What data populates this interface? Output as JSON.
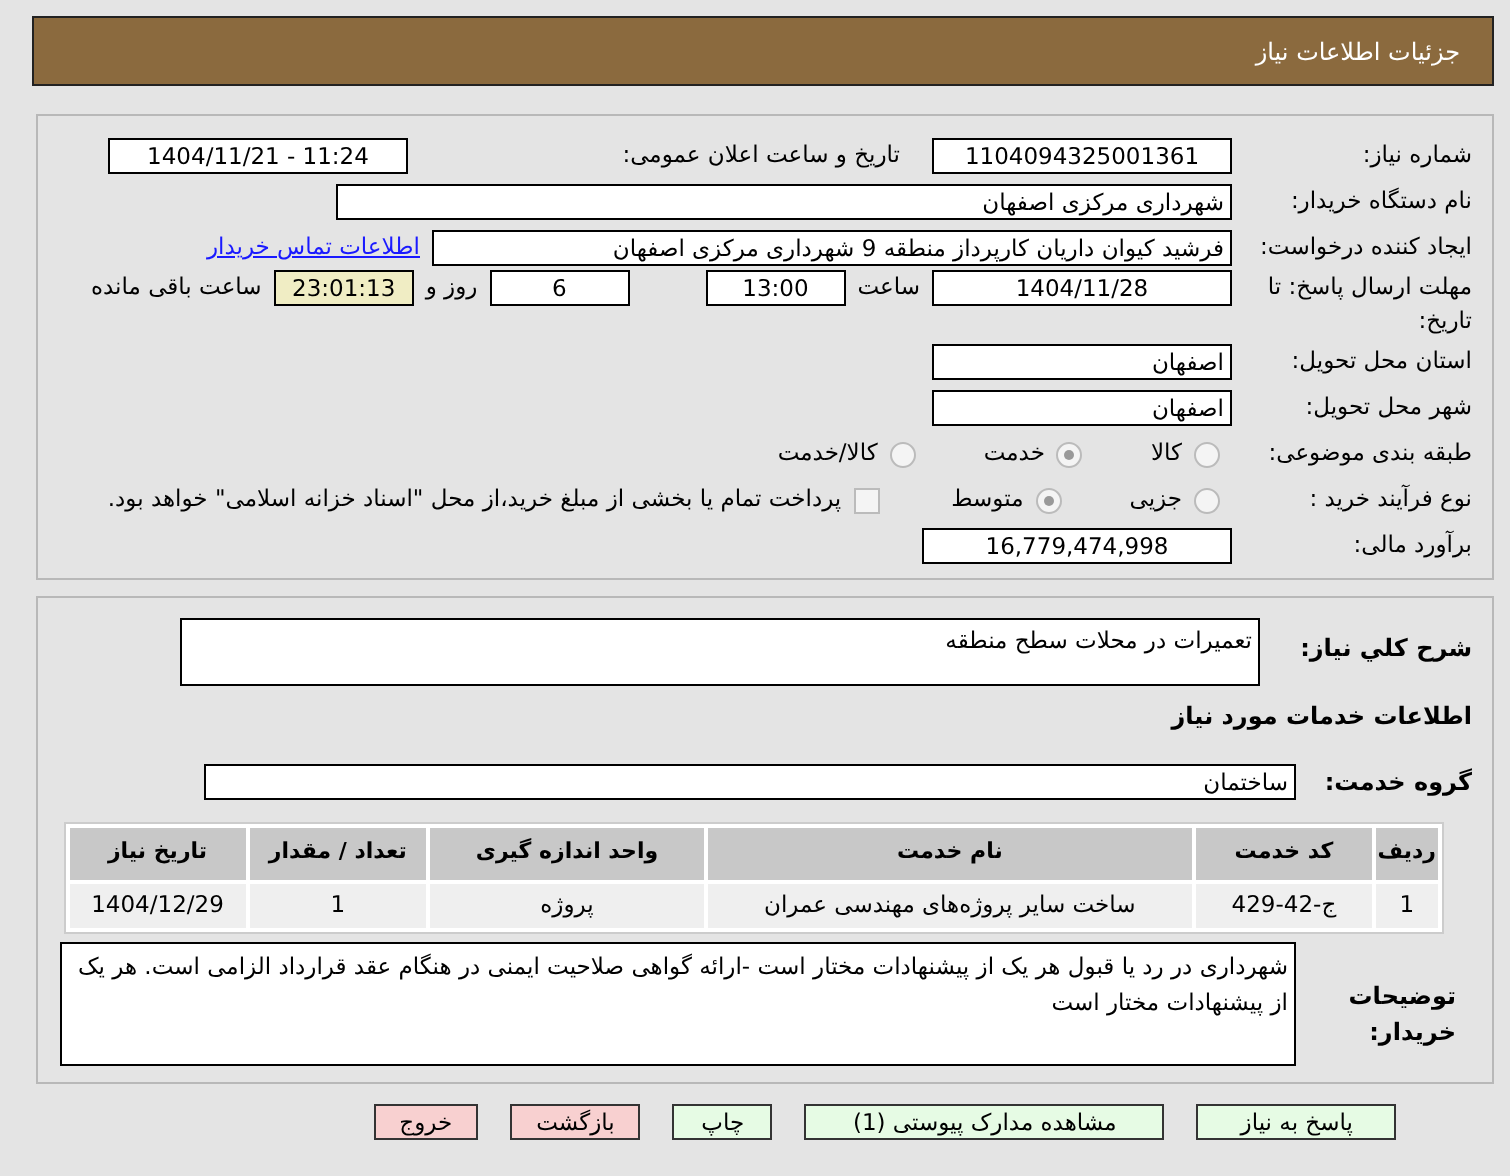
{
  "header": {
    "title": "جزئیات اطلاعات نیاز"
  },
  "need_number": {
    "label": "شماره نیاز:",
    "value": "1104094325001361"
  },
  "announce": {
    "label": "تاریخ و ساعت اعلان عمومی:",
    "value": "1404/11/21 - 11:24"
  },
  "buyer_org": {
    "label": "نام دستگاه خریدار:",
    "value": "شهرداری مرکزی اصفهان"
  },
  "requester": {
    "label": "ایجاد کننده درخواست:",
    "value": "فرشید کیوان داریان کارپرداز منطقه 9 شهرداری مرکزی اصفهان",
    "link": "اطلاعات تماس خریدار"
  },
  "deadline": {
    "label": "مهلت ارسال پاسخ: تا تاریخ:",
    "date": "1404/11/28",
    "time_label": "ساعت",
    "time": "13:00",
    "days": "6",
    "days_label": "روز و",
    "remaining": "23:01:13",
    "remaining_label": "ساعت باقی مانده"
  },
  "province": {
    "label": "استان محل تحویل:",
    "value": "اصفهان"
  },
  "city": {
    "label": "شهر محل تحویل:",
    "value": "اصفهان"
  },
  "category": {
    "label": "طبقه بندی موضوعی:",
    "options": [
      {
        "label": "کالا",
        "selected": false
      },
      {
        "label": "خدمت",
        "selected": true
      },
      {
        "label": "کالا/خدمت",
        "selected": false
      }
    ]
  },
  "process": {
    "label": "نوع فرآیند خرید :",
    "options": [
      {
        "label": "جزیی",
        "selected": false
      },
      {
        "label": "متوسط",
        "selected": true
      }
    ],
    "treasury": {
      "checked": false,
      "label": "پرداخت تمام یا بخشی از مبلغ خرید،از محل \"اسناد خزانه اسلامی\" خواهد بود."
    }
  },
  "estimate": {
    "label": "برآورد مالی:",
    "value": "16,779,474,998"
  },
  "description": {
    "label": "شرح کلي نیاز:",
    "value": "تعمیرات در محلات سطح منطقه"
  },
  "services_heading": "اطلاعات خدمات مورد نیاز",
  "service_group": {
    "label": "گروه خدمت:",
    "value": "ساختمان"
  },
  "table": {
    "columns": [
      "ردیف",
      "کد خدمت",
      "نام خدمت",
      "واحد اندازه گیری",
      "تعداد / مقدار",
      "تاریخ نیاز"
    ],
    "rows": [
      [
        "1",
        "ج-42-429",
        "ساخت سایر پروژه‌های مهندسی عمران",
        "پروژه",
        "1",
        "1404/12/29"
      ]
    ]
  },
  "buyer_notes": {
    "label": "توضیحات خریدار:",
    "value": "شهرداری در رد یا قبول هر یک از پیشنهادات مختار است -ارائه گواهی صلاحیت ایمنی در هنگام عقد قرارداد الزامی است. هر یک از پیشنهادات مختار است"
  },
  "buttons": [
    {
      "label": "پاسخ به نیاز",
      "kind": "action"
    },
    {
      "label": "مشاهده مدارک پیوستی (1)",
      "kind": "action"
    },
    {
      "label": "چاپ",
      "kind": "action"
    },
    {
      "label": "بازگشت",
      "kind": "exit"
    },
    {
      "label": "خروج",
      "kind": "exit"
    }
  ]
}
